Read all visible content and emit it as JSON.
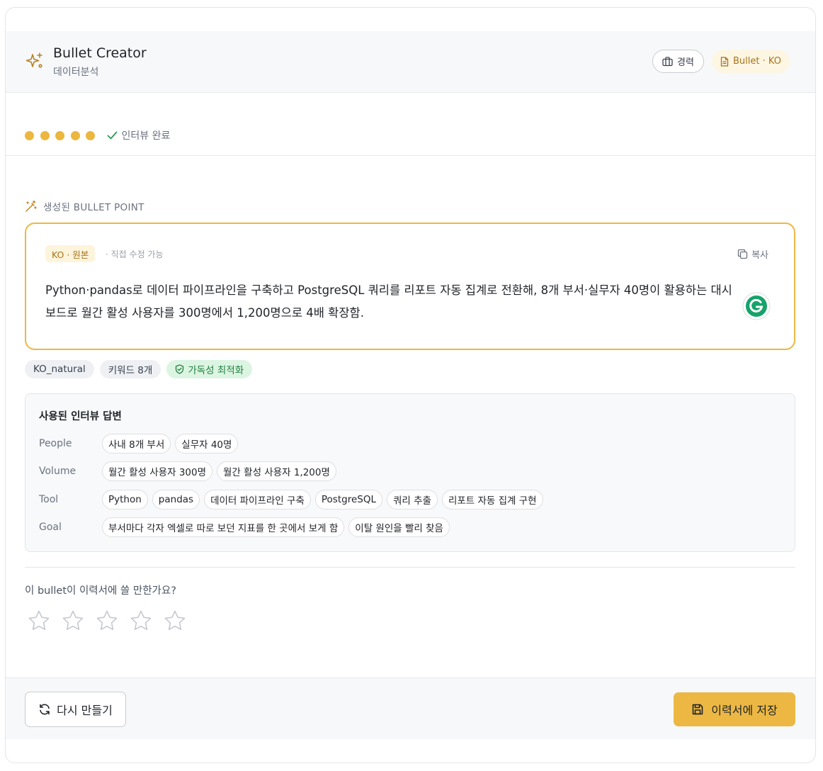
{
  "header": {
    "logo_icon": "sparkles-icon",
    "title": "Bullet Creator",
    "subtitle": "데이터분석",
    "career_pill": {
      "icon": "briefcase-icon",
      "label": "경력"
    },
    "bullet_pill": {
      "icon": "document-icon",
      "label": "Bullet · KO"
    }
  },
  "progress": {
    "steps_completed": 5,
    "steps_total": 5,
    "status_label": "인터뷰 완료",
    "accent_color": "#ebb73e"
  },
  "generated": {
    "section_label": "생성된 BULLET POINT",
    "badge": "KO · 원본",
    "edit_hint": "· 직접 수정 가능",
    "copy_label": "복사",
    "text": "Python·pandas로 데이터 파이프라인을 구축하고 PostgreSQL 쿼리를 리포트 자동 집계로 전환해, 8개 부서·실무자 40명이 활용하는 대시보드로 월간 활성 사용자를 300명에서 1,200명으로 4배 확장함."
  },
  "tags": [
    {
      "label": "KO_natural"
    },
    {
      "label": "키워드 8개"
    },
    {
      "label": "가독성 최적화",
      "icon": "shield-check-icon"
    }
  ],
  "answers": {
    "heading": "사용된 인터뷰 답변",
    "rows": [
      {
        "label": "People",
        "chips": [
          "사내 8개 부서",
          "실무자 40명"
        ]
      },
      {
        "label": "Volume",
        "chips": [
          "월간 활성 사용자 300명",
          "월간 활성 사용자 1,200명"
        ]
      },
      {
        "label": "Tool",
        "chips": [
          "Python",
          "pandas",
          "데이터 파이프라인 구축",
          "PostgreSQL",
          "쿼리 추출",
          "리포트 자동 집계 구현"
        ]
      },
      {
        "label": "Goal",
        "chips": [
          "부서마다 각자 엑셀로 따로 보던 지표를 한 곳에서 보게 함",
          "이탈 원인을 빨리 찾음"
        ]
      }
    ]
  },
  "rating": {
    "question": "이 bullet이 이력서에 쓸 만한가요?",
    "max": 5,
    "value": 0
  },
  "footer": {
    "regenerate_label": "다시 만들기",
    "save_label": "이력서에 저장"
  }
}
